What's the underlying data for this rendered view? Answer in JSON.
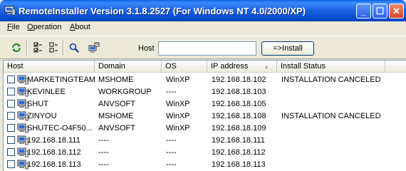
{
  "window": {
    "title": "RemoteInstaller Version 3.1.8.2527 (For Windows NT 4.0/2000/XP)"
  },
  "menu": [
    {
      "label": "File",
      "accel": "F",
      "rest": "ile"
    },
    {
      "label": "Operation",
      "accel": "O",
      "rest": "peration"
    },
    {
      "label": "About",
      "accel": "A",
      "rest": "bout"
    }
  ],
  "toolbar": {
    "host_label": "Host",
    "host_value": "",
    "install_label": "=>Install",
    "icons": [
      "refresh-icon",
      "select-all-icon",
      "deselect-all-icon",
      "search-icon",
      "computer-properties-icon"
    ]
  },
  "columns": {
    "host": "Host",
    "domain": "Domain",
    "os": "OS",
    "ip": "IP address",
    "status": "Install Status"
  },
  "rows": [
    {
      "host": "MARKETINGTEAM",
      "domain": "MSHOME",
      "os": "WinXP",
      "ip": "192.168.18.102",
      "status": "INSTALLATION CANCELED"
    },
    {
      "host": "KEVINLEE",
      "domain": "WORKGROUP",
      "os": "----",
      "ip": "192.168.18.103",
      "status": ""
    },
    {
      "host": "SHUT",
      "domain": "ANVSOFT",
      "os": "WinXP",
      "ip": "192.168.18.105",
      "status": ""
    },
    {
      "host": "ZINYOU",
      "domain": "MSHOME",
      "os": "WinXP",
      "ip": "192.168.18.108",
      "status": "INSTALLATION CANCELED"
    },
    {
      "host": "SHUTEC-O4F50...",
      "domain": "ANVSOFT",
      "os": "WinXP",
      "ip": "192.168.18.109",
      "status": ""
    },
    {
      "host": "192.168.18.111",
      "domain": "----",
      "os": "----",
      "ip": "192.168.18.111",
      "status": ""
    },
    {
      "host": "192.168.18.112",
      "domain": "----",
      "os": "----",
      "ip": "192.168.18.112",
      "status": ""
    },
    {
      "host": "192.168.18.113",
      "domain": "----",
      "os": "----",
      "ip": "192.168.18.113",
      "status": ""
    }
  ]
}
